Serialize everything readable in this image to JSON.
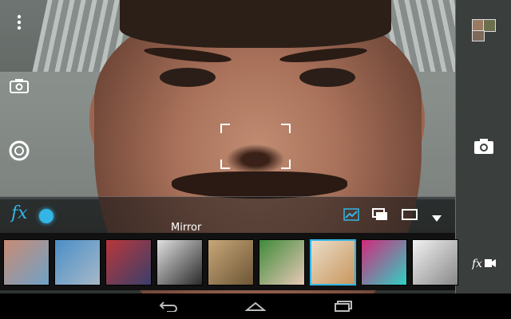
{
  "effects_bar": {
    "fx_label": "fx",
    "mode_label": "Mirror"
  },
  "filmstrip": {
    "items": [
      {
        "name": "filter-thumb-face-split",
        "color_a": "#c98b74",
        "color_b": "#6fa2c7"
      },
      {
        "name": "filter-thumb-car",
        "color_a": "#4a8fc7",
        "color_b": "#a7b8c8"
      },
      {
        "name": "filter-thumb-street",
        "color_a": "#b9373a",
        "color_b": "#3a3f6b"
      },
      {
        "name": "filter-thumb-bw-portrait",
        "color_a": "#e0e0e0",
        "color_b": "#2a2a2a"
      },
      {
        "name": "filter-thumb-sepia-cat",
        "color_a": "#c7a778",
        "color_b": "#6d5636"
      },
      {
        "name": "filter-thumb-woman-green",
        "color_a": "#3e8a3a",
        "color_b": "#e8c9b6"
      },
      {
        "name": "filter-thumb-blonde-selected",
        "color_a": "#e9dcc9",
        "color_b": "#c9975d"
      },
      {
        "name": "filter-thumb-kaleidoscope",
        "color_a": "#d12a7a",
        "color_b": "#2fd1c4"
      },
      {
        "name": "filter-thumb-sketch-cat",
        "color_a": "#f2f2f2",
        "color_b": "#888888"
      }
    ],
    "selected_index": 6
  },
  "colors": {
    "accent": "#33b5e5",
    "panel": "#3a3e3c",
    "background": "#000000"
  },
  "icons": {
    "menu": "overflow-menu-icon",
    "switch_camera": "switch-camera-icon",
    "shutter_mode": "shutter-ring-icon",
    "camera": "camera-icon",
    "fx_video": "fx-video-icon",
    "filter_strength": "filter-graph-icon",
    "frame_overlay": "frame-overlay-icon",
    "aspect": "aspect-ratio-icon",
    "dropdown": "dropdown-arrow-icon",
    "back": "back-icon",
    "home": "home-icon",
    "recents": "recents-icon"
  }
}
